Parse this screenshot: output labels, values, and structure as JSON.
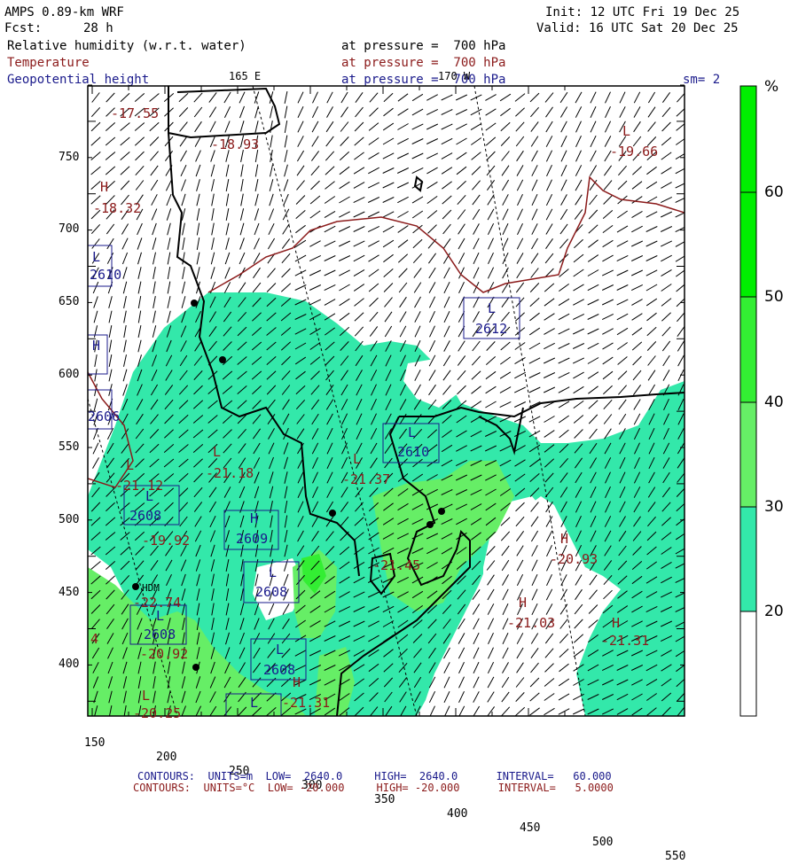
{
  "header": {
    "model": "AMPS 0.89-km WRF",
    "init": "Init: 12 UTC Fri 19 Dec 25",
    "fcst_label": "Fcst:",
    "fcst_value": "28 h",
    "valid": "Valid: 16 UTC Sat 20 Dec 25",
    "fields": [
      {
        "name": "Relative humidity (w.r.t. water)",
        "pressure": "at pressure =  700 hPa",
        "color": "#000000"
      },
      {
        "name": "Temperature",
        "pressure": "at pressure =  700 hPa",
        "color": "#8b1a1a"
      },
      {
        "name": "Geopotential height",
        "pressure": "at pressure =  700 hPa",
        "color": "#1a1a8b"
      }
    ],
    "smoothing": "sm= 2"
  },
  "meridians": {
    "left": "165 E",
    "right": "170 W"
  },
  "axes": {
    "x_ticks": [
      "150",
      "200",
      "250",
      "300",
      "350",
      "400",
      "450",
      "500",
      "550"
    ],
    "y_ticks": [
      "750",
      "700",
      "650",
      "600",
      "550",
      "500",
      "450",
      "400"
    ]
  },
  "colorbar": {
    "unit": "%",
    "ticks": [
      "20",
      "30",
      "40",
      "50",
      "60"
    ],
    "colors": [
      "#ffffff",
      "#33e8aa",
      "#66ee66",
      "#33ee33",
      "#00ee00"
    ]
  },
  "temperature_labels": [
    {
      "text": "-17.55"
    },
    {
      "text": "-18.93"
    },
    {
      "text": "H"
    },
    {
      "text": "-18.32"
    },
    {
      "text": "L"
    },
    {
      "text": "-19.66"
    },
    {
      "text": "L"
    },
    {
      "text": "-21.18"
    },
    {
      "text": "L"
    },
    {
      "text": "-21.37"
    },
    {
      "text": "L"
    },
    {
      "text": "-21.12"
    },
    {
      "text": "-19.92"
    },
    {
      "text": "-21.45"
    },
    {
      "text": "H"
    },
    {
      "text": "-20.93"
    },
    {
      "text": "H"
    },
    {
      "text": "-21.03"
    },
    {
      "text": "H"
    },
    {
      "text": "-21.31"
    },
    {
      "text": "-22.74"
    },
    {
      "text": "-20.92"
    },
    {
      "text": "L"
    },
    {
      "text": "-20.25"
    },
    {
      "text": "4"
    },
    {
      "text": "H"
    },
    {
      "text": "-21.31"
    }
  ],
  "height_labels": [
    {
      "text": "L"
    },
    {
      "text": "2612"
    },
    {
      "text": "L"
    },
    {
      "text": "2610"
    },
    {
      "text": "L"
    },
    {
      "text": "2608"
    },
    {
      "text": "H"
    },
    {
      "text": "2609"
    },
    {
      "text": "L"
    },
    {
      "text": "2608"
    },
    {
      "text": "L"
    },
    {
      "text": "2608"
    },
    {
      "text": "L"
    },
    {
      "text": "2608"
    },
    {
      "text": "L"
    },
    {
      "text": "L"
    },
    {
      "text": "2610"
    },
    {
      "text": "H"
    },
    {
      "text": "2606"
    }
  ],
  "station_label": "HDM",
  "footer": {
    "line1": "CONTOURS:  UNITS=m  LOW=  2640.0     HIGH=  2640.0      INTERVAL=   60.000",
    "line2": "CONTOURS:  UNITS=°C  LOW= -20.000     HIGH= -20.000      INTERVAL=   5.0000"
  }
}
